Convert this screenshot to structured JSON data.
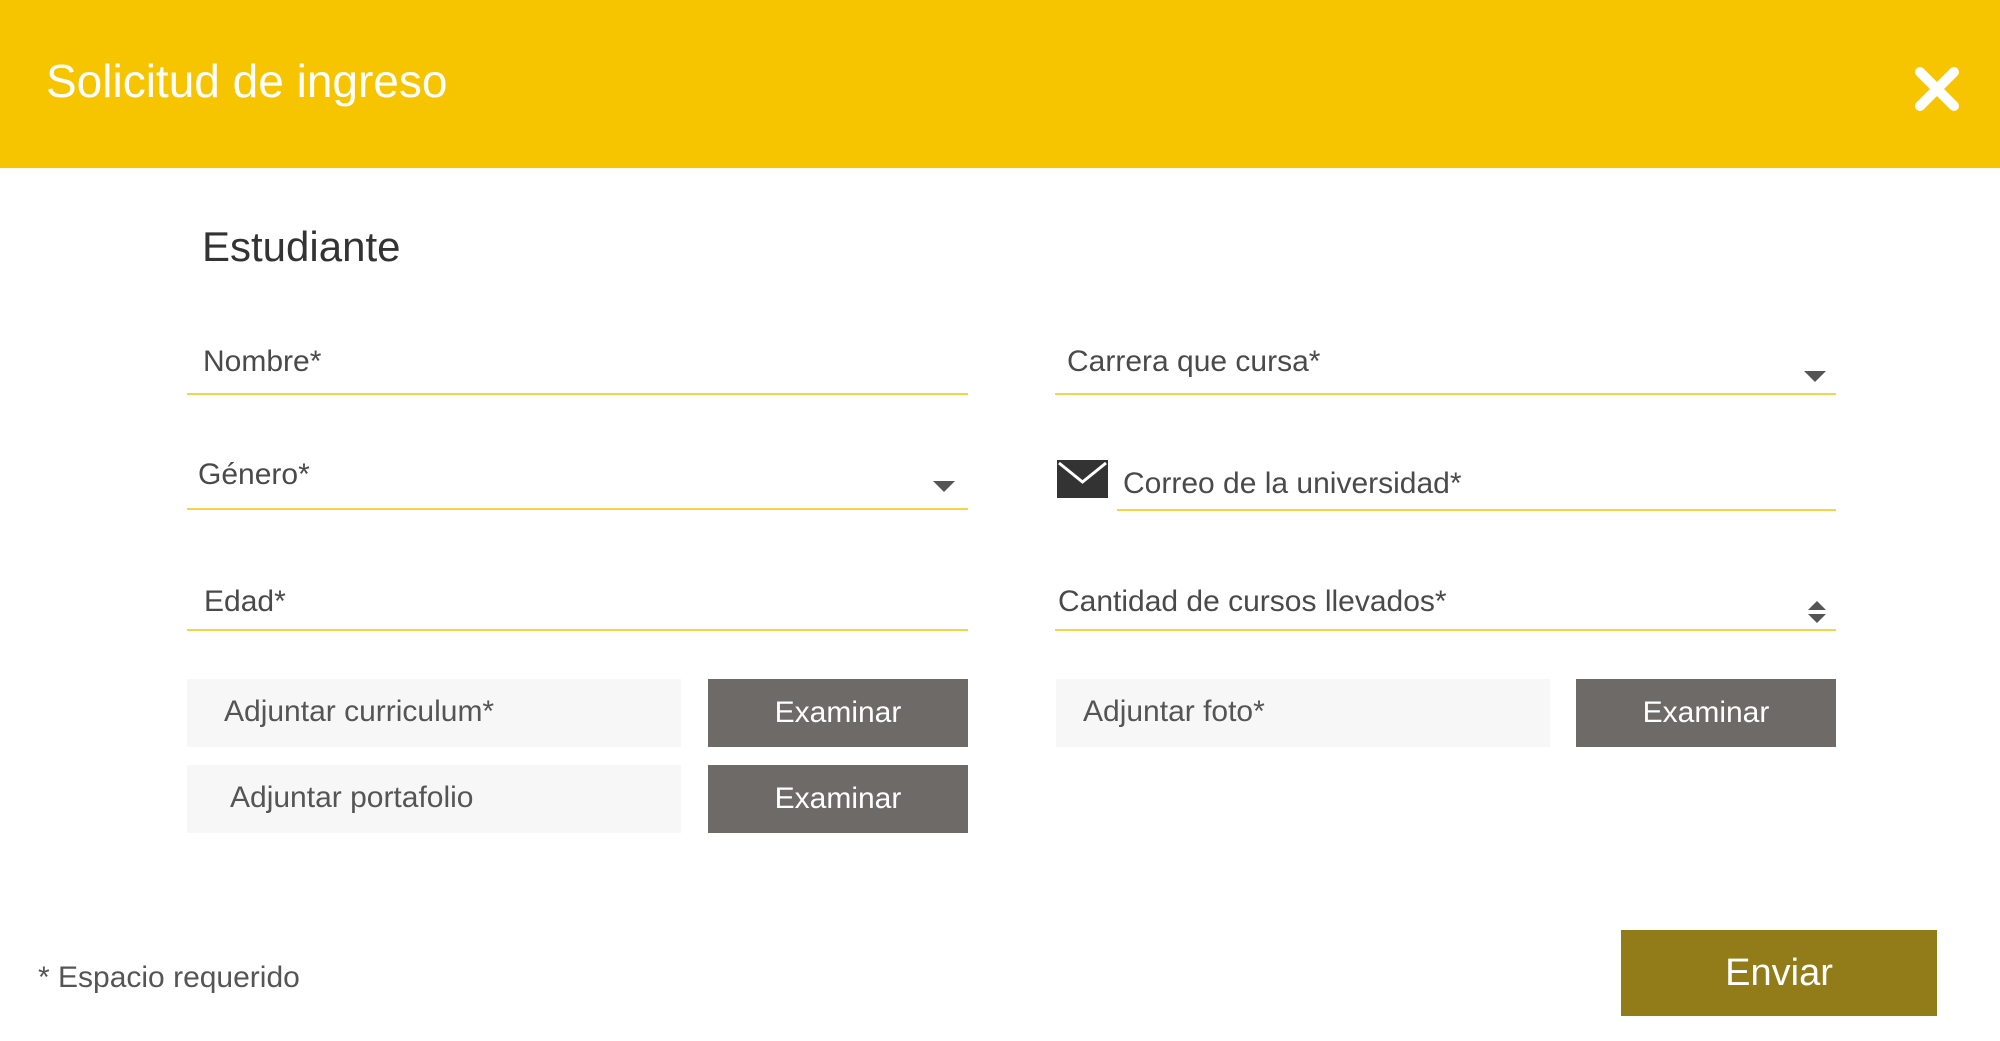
{
  "header": {
    "title": "Solicitud de ingreso",
    "close_icon": "close-icon",
    "background_color": "#F7C400"
  },
  "form": {
    "section_title": "Estudiante",
    "fields": {
      "nombre": {
        "label": "Nombre*"
      },
      "carrera": {
        "label": "Carrera que cursa*",
        "icon": "chevron-down-icon"
      },
      "genero": {
        "label": "Género*",
        "icon": "chevron-down-icon"
      },
      "correo": {
        "label": "Correo de la universidad*",
        "icon": "mail-icon"
      },
      "edad": {
        "label": "Edad*"
      },
      "cantidad": {
        "label": "Cantidad de cursos llevados*",
        "icon": "spinner-icon"
      }
    },
    "attachments": {
      "curriculum": {
        "label": "Adjuntar curriculum*",
        "button": "Examinar"
      },
      "portafolio": {
        "label": "Adjuntar portafolio",
        "button": "Examinar"
      },
      "foto": {
        "label": "Adjuntar foto*",
        "button": "Examinar"
      }
    }
  },
  "footer": {
    "required_note": "* Espacio requerido",
    "submit_label": "Enviar",
    "submit_color": "#927B19",
    "underline_color": "#F5D34A",
    "button_color": "#6E6A67"
  }
}
